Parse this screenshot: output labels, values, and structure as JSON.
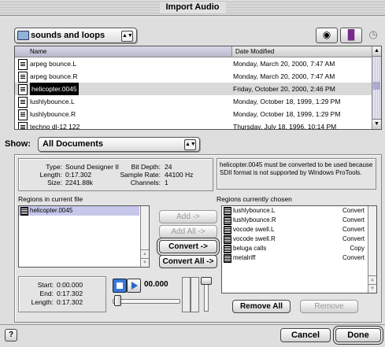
{
  "window": {
    "title": "Import Audio"
  },
  "location": {
    "folder": "sounds and loops"
  },
  "file_list": {
    "columns": [
      "Name",
      "Date Modified"
    ],
    "rows": [
      {
        "name": "arpeg bounce.L",
        "date": "Monday, March 20, 2000, 7:47 AM"
      },
      {
        "name": "arpeg bounce.R",
        "date": "Monday, March 20, 2000, 7:47 AM"
      },
      {
        "name": "helicopter.0045",
        "date": "Friday, October 20, 2000, 2:46 PM"
      },
      {
        "name": "lushlybounce.L",
        "date": "Monday, October 18, 1999, 1:29 PM"
      },
      {
        "name": "lushlybounce.R",
        "date": "Monday, October 18, 1999, 1:29 PM"
      },
      {
        "name": "techno dl-12 122",
        "date": "Thursday, July 18, 1996, 10:14 PM"
      }
    ]
  },
  "show": {
    "label": "Show:",
    "value": "All Documents"
  },
  "file_info": {
    "type_label": "Type:",
    "type": "Sound Designer II",
    "length_label": "Length:",
    "length": "0:17.302",
    "size_label": "Size:",
    "size": "2241.88k",
    "bitdepth_label": "Bit Depth:",
    "bitdepth": "24",
    "rate_label": "Sample Rate:",
    "rate": "44100 Hz",
    "channels_label": "Channels:",
    "channels": "1"
  },
  "message": "helicopter.0045 must be converted to be used because SDII format is not supported by Windows ProTools.",
  "regions_current": {
    "label": "Regions in current file",
    "items": [
      "helicopter.0045"
    ]
  },
  "regions_chosen": {
    "label": "Regions currently chosen",
    "items": [
      {
        "name": "lushlybounce.L",
        "action": "Convert"
      },
      {
        "name": "lushlybounce.R",
        "action": "Convert"
      },
      {
        "name": "vocode swell.L",
        "action": "Convert"
      },
      {
        "name": "vocode swell.R",
        "action": "Convert"
      },
      {
        "name": "beluga calls",
        "action": "Copy"
      },
      {
        "name": "metalriff",
        "action": "Convert"
      }
    ]
  },
  "buttons": {
    "add": "Add ->",
    "add_all": "Add All ->",
    "convert": "Convert ->",
    "convert_all": "Convert All ->",
    "remove_all": "Remove All",
    "remove": "Remove",
    "cancel": "Cancel",
    "done": "Done"
  },
  "playback": {
    "start_label": "Start:",
    "start": "0:00.000",
    "end_label": "End:",
    "end": "0:17.302",
    "length_label": "Length:",
    "length": "0:17.302",
    "position": "00.000"
  },
  "icons": [
    "folder-icon",
    "network-icon",
    "book-icon",
    "history-icon",
    "document-icon",
    "region-icon",
    "play-icon",
    "stop-icon",
    "help-icon"
  ],
  "colors": {
    "selection": "#000000",
    "stop_blue": "#3a78d8",
    "highlight": "#d9d9d9"
  }
}
